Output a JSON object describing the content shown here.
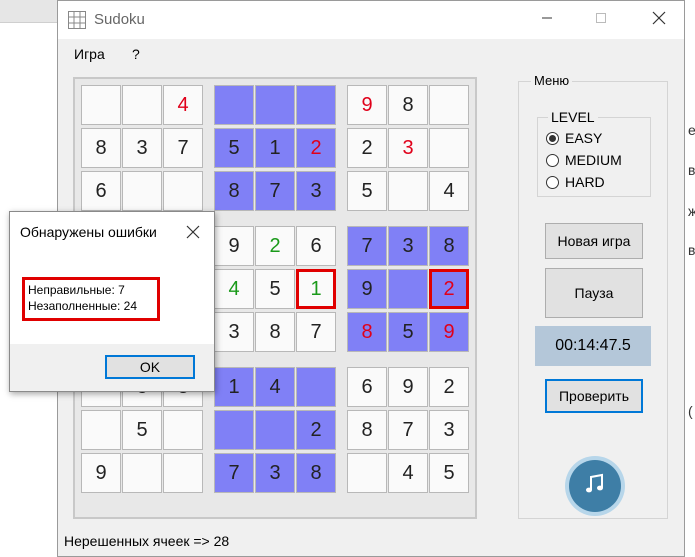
{
  "window": {
    "title": "Sudoku"
  },
  "menu": [
    "Игра",
    "?"
  ],
  "board": {
    "rows": [
      [
        {
          "v": "",
          "c": "",
          "bg": "white"
        },
        {
          "v": "",
          "c": "",
          "bg": "white"
        },
        {
          "v": "4",
          "c": "#e0001a",
          "bg": "white"
        },
        {
          "v": "",
          "c": "",
          "bg": "blue"
        },
        {
          "v": "",
          "c": "",
          "bg": "blue"
        },
        {
          "v": "",
          "c": "",
          "bg": "blue"
        },
        {
          "v": "9",
          "c": "#e0001a",
          "bg": "white"
        },
        {
          "v": "8",
          "c": "#222222",
          "bg": "white"
        },
        {
          "v": "",
          "c": "",
          "bg": "white"
        }
      ],
      [
        {
          "v": "8",
          "c": "#222222",
          "bg": "white"
        },
        {
          "v": "3",
          "c": "#222222",
          "bg": "white"
        },
        {
          "v": "7",
          "c": "#222222",
          "bg": "white"
        },
        {
          "v": "5",
          "c": "#222222",
          "bg": "blue"
        },
        {
          "v": "1",
          "c": "#222222",
          "bg": "blue"
        },
        {
          "v": "2",
          "c": "#e0001a",
          "bg": "blue"
        },
        {
          "v": "2",
          "c": "#222222",
          "bg": "white"
        },
        {
          "v": "3",
          "c": "#e0001a",
          "bg": "white"
        },
        {
          "v": "",
          "c": "",
          "bg": "white"
        }
      ],
      [
        {
          "v": "6",
          "c": "#222222",
          "bg": "white"
        },
        {
          "v": "",
          "c": "",
          "bg": "white"
        },
        {
          "v": "",
          "c": "",
          "bg": "white"
        },
        {
          "v": "8",
          "c": "#222222",
          "bg": "blue"
        },
        {
          "v": "7",
          "c": "#222222",
          "bg": "blue"
        },
        {
          "v": "3",
          "c": "#222222",
          "bg": "blue"
        },
        {
          "v": "5",
          "c": "#222222",
          "bg": "white"
        },
        {
          "v": "",
          "c": "",
          "bg": "white"
        },
        {
          "v": "4",
          "c": "#222222",
          "bg": "white"
        }
      ],
      [
        {
          "v": "",
          "c": "",
          "bg": "white"
        },
        {
          "v": "",
          "c": "",
          "bg": "white"
        },
        {
          "v": "",
          "c": "",
          "bg": "white"
        },
        {
          "v": "9",
          "c": "#222222",
          "bg": "white"
        },
        {
          "v": "2",
          "c": "#1a9a1a",
          "bg": "white"
        },
        {
          "v": "6",
          "c": "#222222",
          "bg": "white"
        },
        {
          "v": "7",
          "c": "#222222",
          "bg": "blue"
        },
        {
          "v": "3",
          "c": "#222222",
          "bg": "blue"
        },
        {
          "v": "8",
          "c": "#222222",
          "bg": "blue"
        }
      ],
      [
        {
          "v": "",
          "c": "",
          "bg": "white"
        },
        {
          "v": "",
          "c": "",
          "bg": "white"
        },
        {
          "v": "",
          "c": "",
          "bg": "white"
        },
        {
          "v": "4",
          "c": "#1a9a1a",
          "bg": "white"
        },
        {
          "v": "5",
          "c": "#222222",
          "bg": "white"
        },
        {
          "v": "1",
          "c": "#1a9a1a",
          "bg": "white",
          "err": true
        },
        {
          "v": "9",
          "c": "#222222",
          "bg": "blue"
        },
        {
          "v": "",
          "c": "",
          "bg": "blue"
        },
        {
          "v": "2",
          "c": "#e0001a",
          "bg": "blue",
          "err": true
        }
      ],
      [
        {
          "v": "",
          "c": "",
          "bg": "white"
        },
        {
          "v": "",
          "c": "",
          "bg": "white"
        },
        {
          "v": "",
          "c": "",
          "bg": "white"
        },
        {
          "v": "3",
          "c": "#222222",
          "bg": "white"
        },
        {
          "v": "8",
          "c": "#222222",
          "bg": "white"
        },
        {
          "v": "7",
          "c": "#222222",
          "bg": "white"
        },
        {
          "v": "8",
          "c": "#e0001a",
          "bg": "blue"
        },
        {
          "v": "5",
          "c": "#222222",
          "bg": "blue"
        },
        {
          "v": "9",
          "c": "#e0001a",
          "bg": "blue"
        }
      ],
      [
        {
          "v": "",
          "c": "",
          "bg": "white"
        },
        {
          "v": "8",
          "c": "#222222",
          "bg": "white"
        },
        {
          "v": "3",
          "c": "#222222",
          "bg": "white"
        },
        {
          "v": "1",
          "c": "#222222",
          "bg": "blue"
        },
        {
          "v": "4",
          "c": "#222222",
          "bg": "blue"
        },
        {
          "v": "",
          "c": "",
          "bg": "blue"
        },
        {
          "v": "6",
          "c": "#222222",
          "bg": "white"
        },
        {
          "v": "9",
          "c": "#222222",
          "bg": "white"
        },
        {
          "v": "2",
          "c": "#222222",
          "bg": "white"
        }
      ],
      [
        {
          "v": "",
          "c": "",
          "bg": "white"
        },
        {
          "v": "5",
          "c": "#222222",
          "bg": "white"
        },
        {
          "v": "",
          "c": "",
          "bg": "white"
        },
        {
          "v": "",
          "c": "",
          "bg": "blue"
        },
        {
          "v": "",
          "c": "",
          "bg": "blue"
        },
        {
          "v": "2",
          "c": "#222222",
          "bg": "blue"
        },
        {
          "v": "8",
          "c": "#222222",
          "bg": "white"
        },
        {
          "v": "7",
          "c": "#222222",
          "bg": "white"
        },
        {
          "v": "3",
          "c": "#222222",
          "bg": "white"
        }
      ],
      [
        {
          "v": "9",
          "c": "#222222",
          "bg": "white"
        },
        {
          "v": "",
          "c": "",
          "bg": "white"
        },
        {
          "v": "",
          "c": "",
          "bg": "white"
        },
        {
          "v": "7",
          "c": "#222222",
          "bg": "blue"
        },
        {
          "v": "3",
          "c": "#222222",
          "bg": "blue"
        },
        {
          "v": "8",
          "c": "#222222",
          "bg": "blue"
        },
        {
          "v": "",
          "c": "",
          "bg": "white"
        },
        {
          "v": "4",
          "c": "#222222",
          "bg": "white"
        },
        {
          "v": "5",
          "c": "#222222",
          "bg": "white"
        }
      ]
    ]
  },
  "sidebar": {
    "legend": "Меню",
    "level": {
      "legend": "LEVEL",
      "options": [
        {
          "label": "EASY",
          "selected": true
        },
        {
          "label": "MEDIUM",
          "selected": false
        },
        {
          "label": "HARD",
          "selected": false
        }
      ]
    },
    "new_game": "Новая игра",
    "pause": "Пауза",
    "timer": "00:14:47.5",
    "check": "Проверить",
    "music_icon": "music-note-icon"
  },
  "status": "Нерешенных ячеек => 28",
  "dialog": {
    "title": "Обнаружены ошибки",
    "line1": "Неправильные: 7",
    "line2": "Незаполненные: 24",
    "ok": "OK"
  },
  "background_text": [
    "е",
    "в",
    "ж",
    "в",
    "("
  ]
}
